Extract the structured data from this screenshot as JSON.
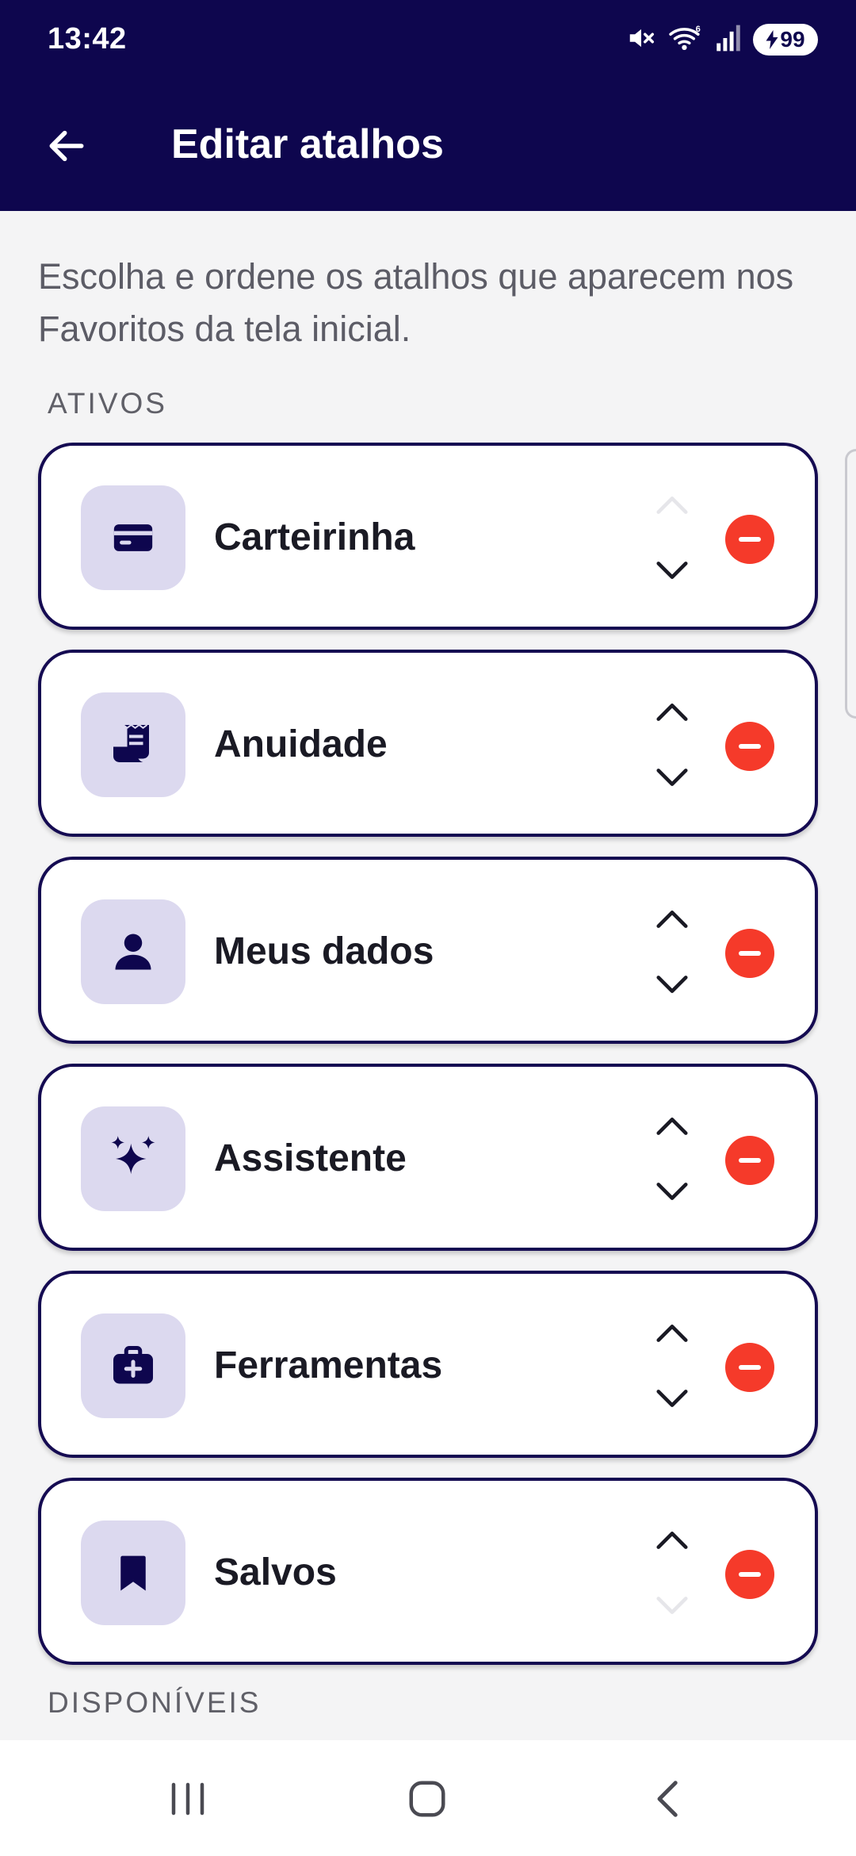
{
  "status_bar": {
    "time": "13:42",
    "battery": "99"
  },
  "app_bar": {
    "title": "Editar atalhos"
  },
  "description": "Escolha e ordene os atalhos que aparecem nos Favoritos da tela inicial.",
  "sections": {
    "active": "ATIVOS",
    "available": "DISPONÍVEIS"
  },
  "colors": {
    "header_bg": "#0e064e",
    "card_border": "#150b52",
    "tile_bg": "#dcd9ef",
    "remove": "#f53a2a"
  },
  "active_shortcuts": [
    {
      "label": "Carteirinha",
      "icon": "card-icon",
      "up_enabled": false,
      "down_enabled": true
    },
    {
      "label": "Anuidade",
      "icon": "receipt-icon",
      "up_enabled": true,
      "down_enabled": true
    },
    {
      "label": "Meus dados",
      "icon": "person-icon",
      "up_enabled": true,
      "down_enabled": true
    },
    {
      "label": "Assistente",
      "icon": "sparkles-icon",
      "up_enabled": true,
      "down_enabled": true
    },
    {
      "label": "Ferramentas",
      "icon": "medical-bag-icon",
      "up_enabled": true,
      "down_enabled": true
    },
    {
      "label": "Salvos",
      "icon": "bookmark-icon",
      "up_enabled": true,
      "down_enabled": false
    }
  ]
}
